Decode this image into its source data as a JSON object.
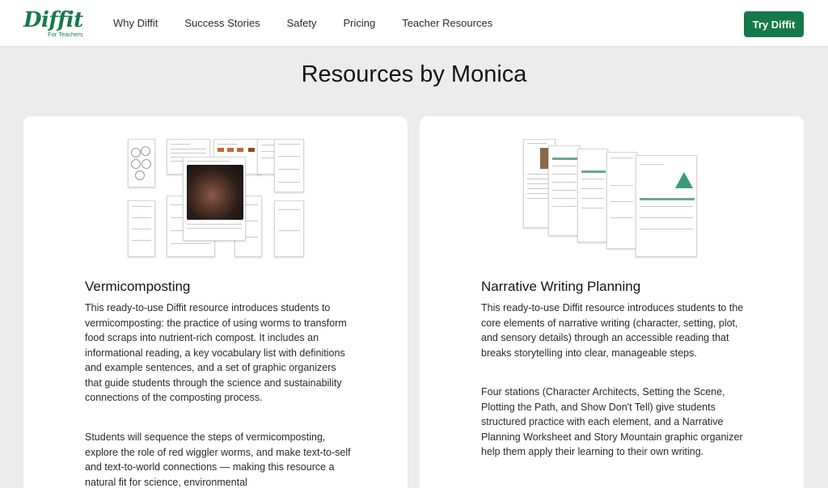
{
  "header": {
    "logo_text": "Diffit",
    "logo_subtext": "For Teachers",
    "nav": [
      "Why Diffit",
      "Success Stories",
      "Safety",
      "Pricing",
      "Teacher Resources"
    ],
    "cta_label": "Try Diffit"
  },
  "page_title": "Resources by Monica",
  "cards": [
    {
      "title": "Vermicomposting",
      "paragraphs": [
        "This ready-to-use Diffit resource introduces students to vermicomposting: the practice of using worms to transform food scraps into nutrient-rich compost. It includes an informational reading, a key vocabulary list with definitions and example sentences, and a set of graphic organizers that guide students through the science and sustainability connections of the composting process.",
        "Students will sequence the steps of vermicomposting, explore the role of red wiggler worms, and make text-to-self and text-to-world connections — making this resource a natural fit for science, environmental"
      ]
    },
    {
      "title": "Narrative Writing Planning",
      "paragraphs": [
        "This ready-to-use Diffit resource introduces students to the core elements of narrative writing (character, setting, plot, and sensory details) through an accessible reading that breaks storytelling into clear, manageable steps.",
        "Four stations (Character Architects, Setting the Scene, Plotting the Path, and Show Don't Tell) give students structured practice with each element, and a Narrative Planning Worksheet and Story Mountain graphic organizer help them apply their learning to their own writing."
      ]
    }
  ],
  "colors": {
    "brand_green": "#15794b",
    "page_background": "#ececec",
    "card_background": "#ffffff"
  }
}
